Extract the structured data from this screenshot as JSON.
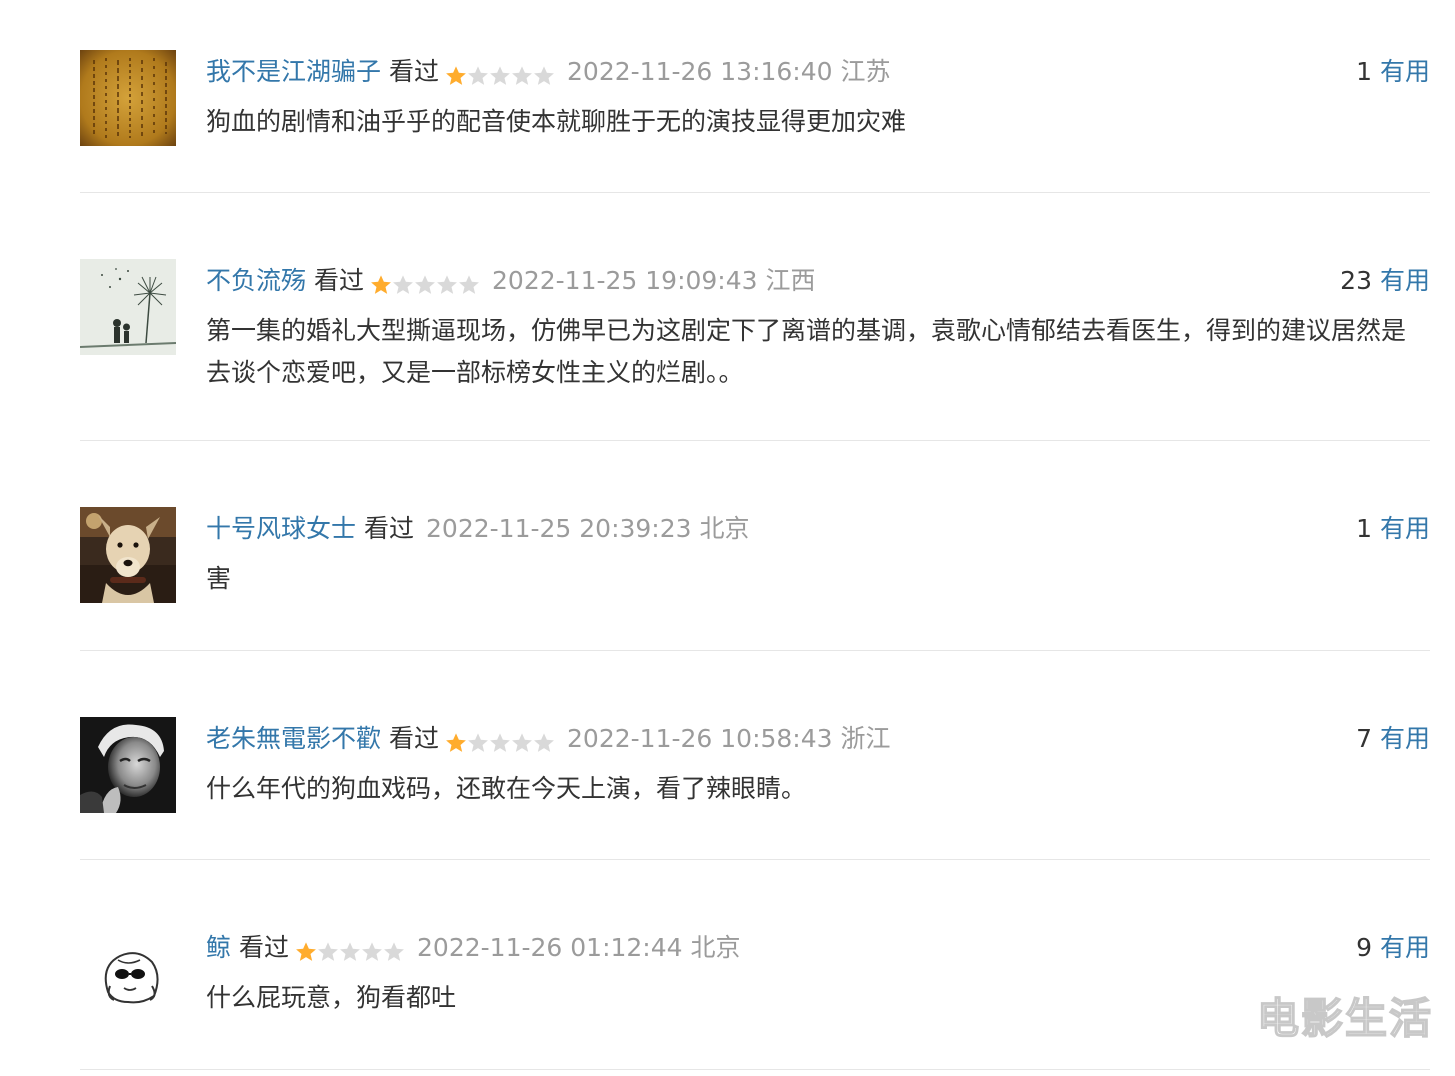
{
  "comments": [
    {
      "author": "我不是江湖骗子",
      "status": "看过",
      "rating": 1,
      "time": "2022-11-26 13:16:40",
      "location": "江苏",
      "votes": "1",
      "useful_label": "有用",
      "content": "狗血的剧情和油乎乎的配音使本就聊胜于无的演技显得更加灾难",
      "avatar": "calligraphy-avatar"
    },
    {
      "author": "不负流殇",
      "status": "看过",
      "rating": 1,
      "time": "2022-11-25 19:09:43",
      "location": "江西",
      "votes": "23",
      "useful_label": "有用",
      "content": "第一集的婚礼大型撕逼现场，仿佛早已为这剧定下了离谱的基调，袁歌心情郁结去看医生，得到的建议居然是去谈个恋爱吧，又是一部标榜女性主义的烂剧。。",
      "avatar": "dandelion-avatar"
    },
    {
      "author": "十号风球女士",
      "status": "看过",
      "rating": 0,
      "time": "2022-11-25 20:39:23",
      "location": "北京",
      "votes": "1",
      "useful_label": "有用",
      "content": "害",
      "avatar": "dog-avatar"
    },
    {
      "author": "老朱無電影不歡",
      "status": "看过",
      "rating": 1,
      "time": "2022-11-26 10:58:43",
      "location": "浙江",
      "votes": "7",
      "useful_label": "有用",
      "content": "什么年代的狗血戏码，还敢在今天上演，看了辣眼睛。",
      "avatar": "portrait-avatar"
    },
    {
      "author": "鲸",
      "status": "看过",
      "rating": 1,
      "time": "2022-11-26 01:12:44",
      "location": "北京",
      "votes": "9",
      "useful_label": "有用",
      "content": "什么屁玩意，狗看都吐",
      "avatar": "cartoon-avatar"
    }
  ],
  "watermark": "电影生活",
  "colors": {
    "link": "#3377aa",
    "star_on": "#ffac2d",
    "star_off": "#d9d9d9",
    "meta": "#9b9b9b",
    "text": "#333333"
  }
}
